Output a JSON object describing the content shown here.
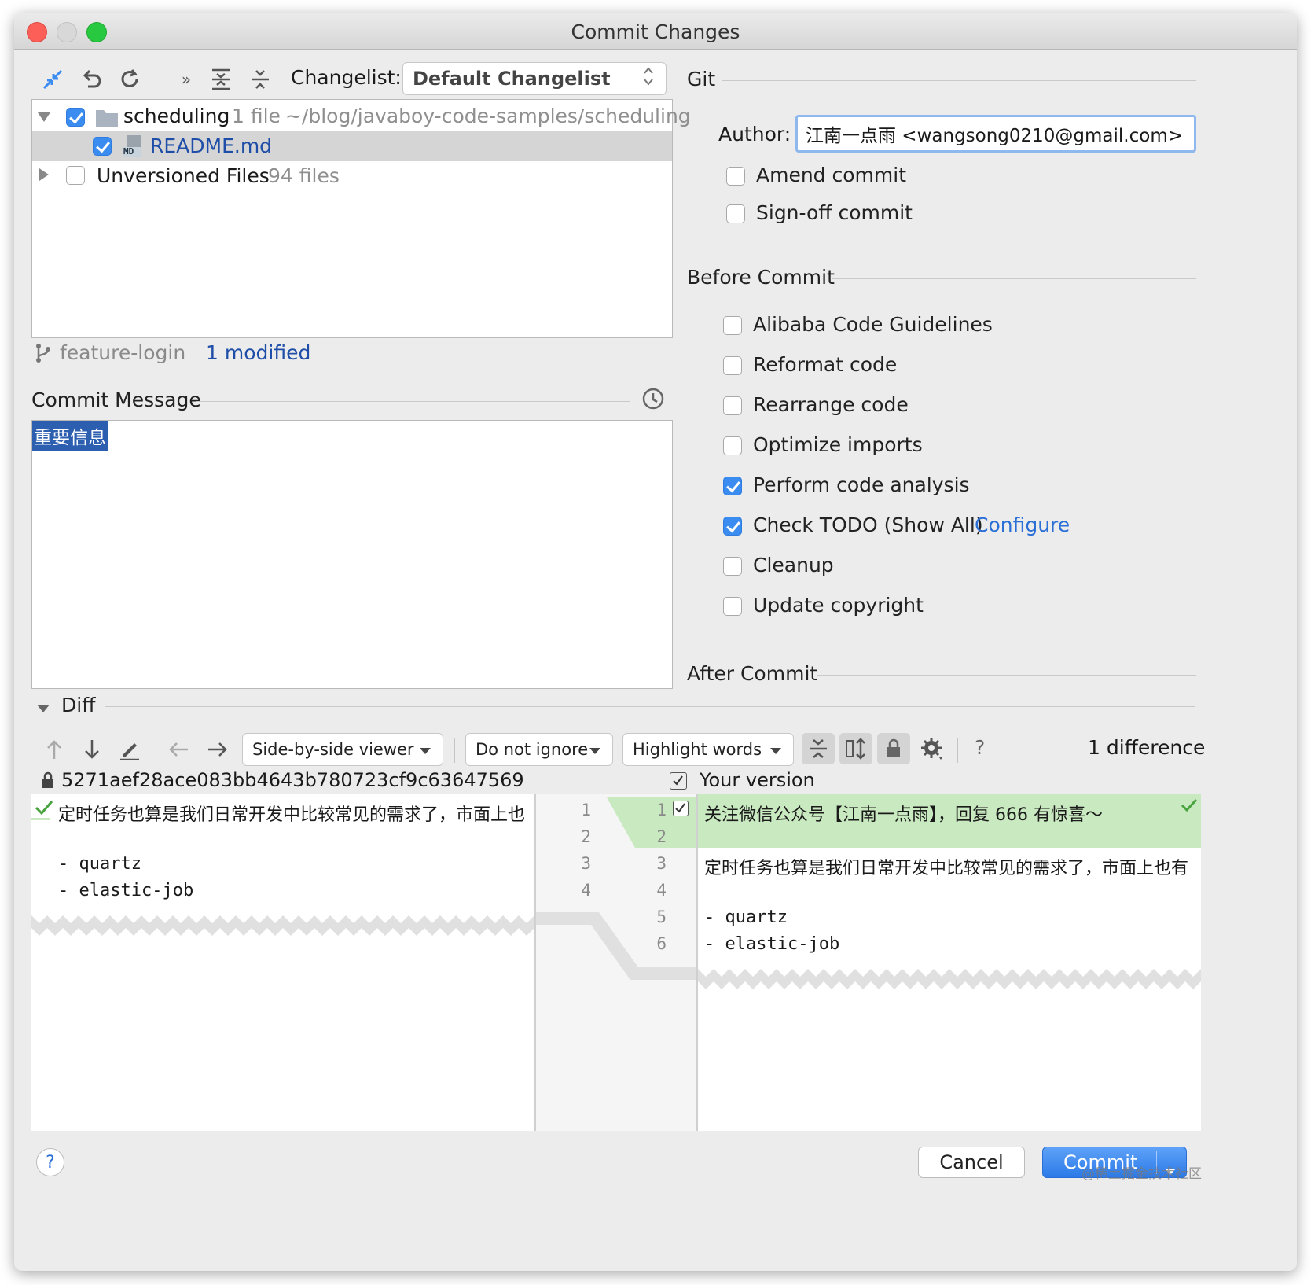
{
  "window": {
    "title": "Commit Changes"
  },
  "toolbar": {
    "changelist_label": "Changelist:",
    "changelist_value": "Default Changelist"
  },
  "changes_tree": {
    "root": {
      "name": "scheduling",
      "count": "1 file",
      "path": "~/blog/javaboy-code-samples/scheduling",
      "checked": true
    },
    "file": {
      "name": "README.md",
      "badge": "MD",
      "checked": true
    },
    "unversioned": {
      "name": "Unversioned Files",
      "count": "94 files",
      "checked": false
    }
  },
  "status": {
    "branch": "feature-login",
    "modified": "1 modified"
  },
  "commit_message": {
    "label": "Commit Message",
    "text": "重要信息"
  },
  "git": {
    "section_title": "Git",
    "author_label": "Author:",
    "author_value": "江南一点雨 <wangsong0210@gmail.com>",
    "amend": "Amend commit",
    "signoff": "Sign-off commit"
  },
  "before_commit": {
    "title": "Before Commit",
    "options": [
      {
        "label": "Alibaba Code Guidelines",
        "checked": false
      },
      {
        "label": "Reformat code",
        "checked": false
      },
      {
        "label": "Rearrange code",
        "checked": false
      },
      {
        "label": "Optimize imports",
        "checked": false
      },
      {
        "label": "Perform code analysis",
        "checked": true
      },
      {
        "label": "Check TODO (Show All)",
        "checked": true,
        "link": "Configure"
      },
      {
        "label": "Cleanup",
        "checked": false
      },
      {
        "label": "Update copyright",
        "checked": false
      }
    ]
  },
  "after_commit": {
    "title": "After Commit"
  },
  "diff": {
    "title": "Diff",
    "viewer": "Side-by-side viewer",
    "ignore": "Do not ignore",
    "highlight": "Highlight words",
    "help": "?",
    "difference_count": "1 difference",
    "left_header": "5271aef28ace083bb4643b780723cf9c63647569",
    "right_header": "Your version",
    "left_lines": [
      "定时任务也算是我们日常开发中比较常见的需求了，市面上也",
      "",
      "- quartz",
      "- elastic-job"
    ],
    "left_numbers": [
      "1",
      "2",
      "3",
      "4"
    ],
    "right_numbers": [
      "1",
      "2",
      "3",
      "4",
      "5",
      "6"
    ],
    "right_lines": [
      "关注微信公众号【江南一点雨】，回复 666 有惊喜～",
      "",
      "定时任务也算是我们日常开发中比较常见的需求了，市面上也有",
      "",
      "- quartz",
      "- elastic-job"
    ]
  },
  "footer": {
    "help": "?",
    "cancel": "Cancel",
    "commit": "Commit"
  },
  "watermark": "@稀土掘金技术社区",
  "colors": {
    "accent": "#3b8cf0",
    "link": "#2a6fd6",
    "diff_added": "#c9e9c0",
    "commit_button": "#2c7ae8"
  }
}
